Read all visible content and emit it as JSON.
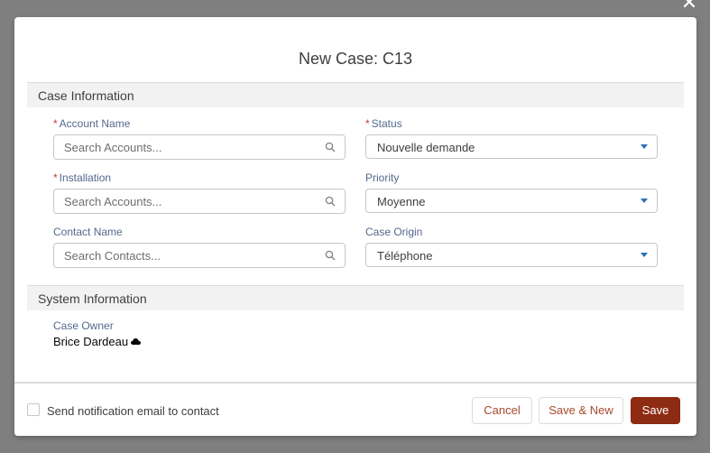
{
  "modal": {
    "title": "New Case: C13",
    "close_icon": "close-icon"
  },
  "sections": {
    "case_information": "Case Information",
    "system_information": "System Information"
  },
  "fields": {
    "account_name": {
      "label": "Account Name",
      "required": true,
      "placeholder": "Search Accounts...",
      "value": ""
    },
    "installation": {
      "label": "Installation",
      "required": true,
      "placeholder": "Search Accounts...",
      "value": ""
    },
    "contact_name": {
      "label": "Contact Name",
      "required": false,
      "placeholder": "Search Contacts...",
      "value": ""
    },
    "status": {
      "label": "Status",
      "required": true,
      "value": "Nouvelle demande"
    },
    "priority": {
      "label": "Priority",
      "required": false,
      "value": "Moyenne"
    },
    "case_origin": {
      "label": "Case Origin",
      "required": false,
      "value": "Téléphone"
    },
    "case_owner": {
      "label": "Case Owner",
      "value": "Brice Dardeau"
    }
  },
  "footer": {
    "notify_label": "Send notification email to contact",
    "notify_checked": false,
    "cancel_label": "Cancel",
    "save_new_label": "Save & New",
    "save_label": "Save"
  },
  "colors": {
    "backdrop": "#7f7f7f",
    "required_star": "#c23934",
    "brand_button": "#8e2c13",
    "neutral_button_text": "#a74a2c",
    "select_caret": "#2a6fb5"
  },
  "required_mark": "*"
}
